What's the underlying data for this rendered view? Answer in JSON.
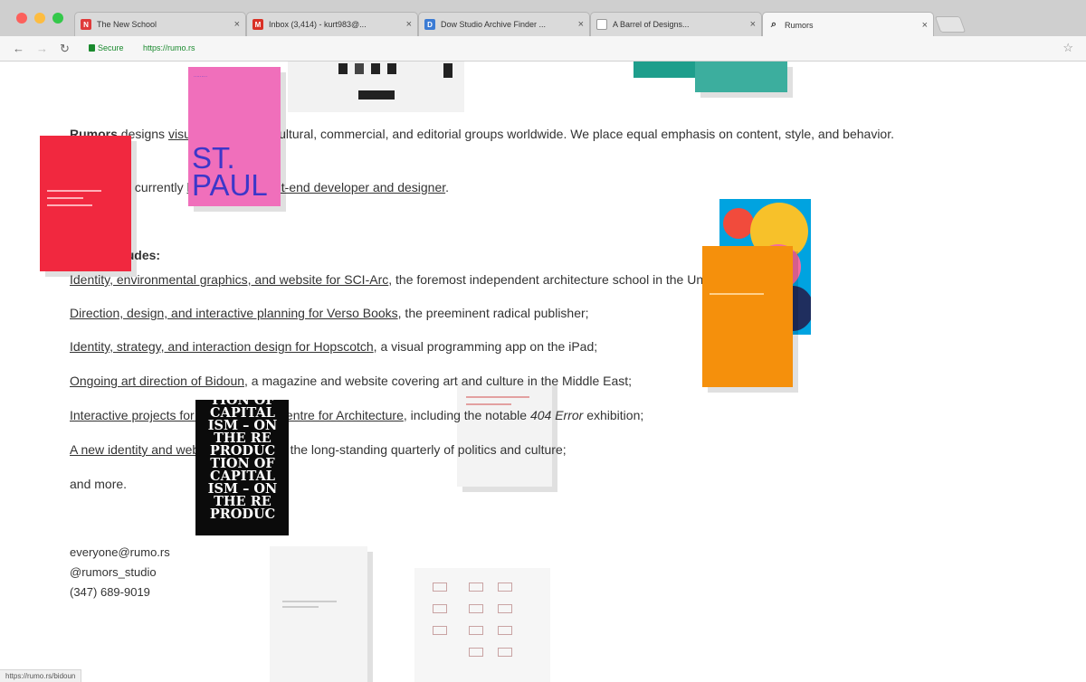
{
  "browser": {
    "tabs": [
      {
        "title": "The New School",
        "favicon_color": "#e03a3a",
        "favicon_letter": "N",
        "active": false
      },
      {
        "title": "Inbox (3,414) - kurt983@...",
        "favicon_color": "#d93025",
        "favicon_letter": "M",
        "active": false
      },
      {
        "title": "Dow Studio Archive Finder ...",
        "favicon_color": "#3b7bd4",
        "favicon_letter": "D",
        "active": false
      },
      {
        "title": "A Barrel of Designs...",
        "favicon_color": "#ffffff",
        "favicon_letter": "",
        "active": false
      },
      {
        "title": "Rumors",
        "favicon_color": "#f6f6f6",
        "favicon_letter": "",
        "active": true
      }
    ],
    "secure_label": "Secure",
    "url": "https://rumo.rs",
    "status_url": "https://rumo.rs/bidoun"
  },
  "intro": {
    "brand": "Rumors",
    "text_a": " designs ",
    "link_visual_systems": "visual systems",
    "text_b": " for cultural, commercial, and editorial groups worldwide. We place equal emphasis on content, style, and behavior."
  },
  "hiring": {
    "text_a": "Also, we're currently ",
    "link": "looking for a front-end developer and designer",
    "text_b": "."
  },
  "work": {
    "heading": "Work includes:",
    "items": [
      {
        "link": "Identity, environmental graphics, and website for SCI-Arc",
        "rest": ", the foremost independent architecture school in the United States;"
      },
      {
        "link": "Direction, design, and interactive planning for Verso Books",
        "rest": ", the preeminent radical publisher;"
      },
      {
        "link": "Identity, strategy, and interaction design for Hopscotch",
        "rest": ", a visual programming app on the iPad;"
      },
      {
        "link": "Ongoing art direction of Bidoun",
        "rest": ", a magazine and website covering art and culture in the Middle East;"
      },
      {
        "link": "Interactive projects for the Canadian Centre for Architecture",
        "rest": ", including the notable ",
        "em": "404 Error",
        "rest2": " exhibition;"
      },
      {
        "link": "A new identity and website for Dissent",
        "rest": ", the long-standing quarterly of politics and culture;"
      },
      {
        "link": "",
        "rest": "and more."
      }
    ]
  },
  "contact": {
    "email": "everyone@rumo.rs",
    "handle": "@rumors_studio",
    "phone": "(347) 689-9019"
  },
  "images": {
    "st_paul_big": "ST. PAUL",
    "black_poster_text": "TION OF CAPITAL ISM – ON THE RE PRODUC TION OF CAPITAL ISM – ON THE RE PRODUC"
  }
}
